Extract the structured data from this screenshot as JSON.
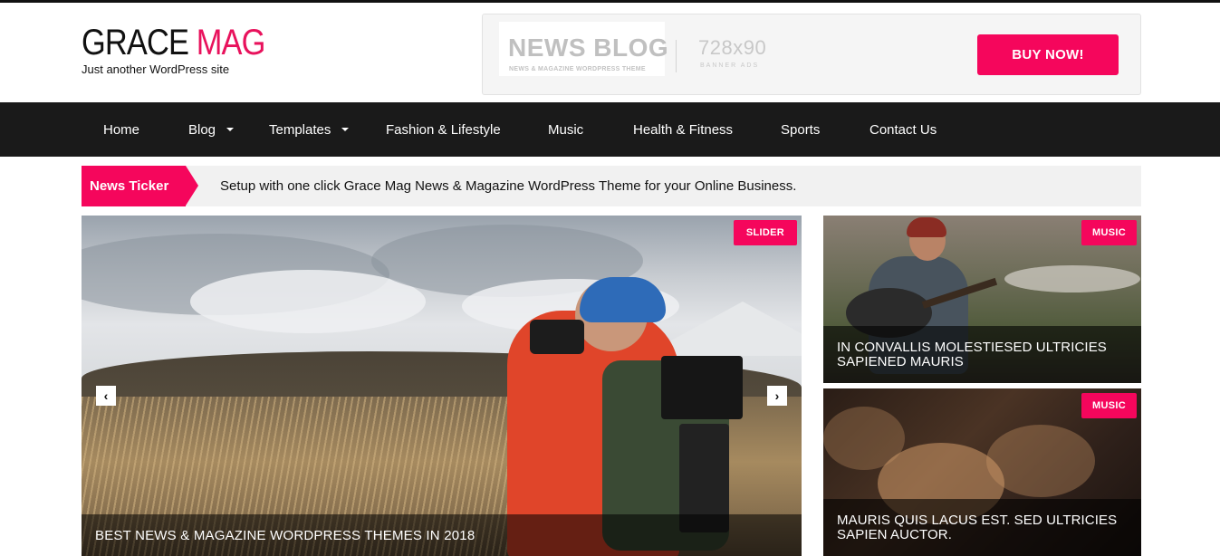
{
  "header": {
    "logo_word1": "GRACE",
    "logo_word2": "MAG",
    "tagline": "Just another WordPress site"
  },
  "banner": {
    "logo_title": "NEWS BLOG",
    "logo_subtitle": "NEWS & MAGAZINE WORDPRESS THEME",
    "size_label": "728x90",
    "ads_label": "BANNER ADS",
    "buy_label": "BUY NOW!"
  },
  "nav": {
    "items": [
      {
        "label": "Home"
      },
      {
        "label": "Blog"
      },
      {
        "label": "Templates"
      },
      {
        "label": "Fashion & Lifestyle"
      },
      {
        "label": "Music"
      },
      {
        "label": "Health & Fitness"
      },
      {
        "label": "Sports"
      },
      {
        "label": "Contact Us"
      }
    ]
  },
  "ticker": {
    "label": "News Ticker",
    "text": "Setup with one click Grace Mag News & Magazine WordPress Theme for your Online Business."
  },
  "slider": {
    "badge": "SLIDER",
    "prev_icon": "‹",
    "next_icon": "›",
    "caption": "BEST NEWS & MAGAZINE WORDPRESS THEMES IN 2018"
  },
  "side_posts": [
    {
      "badge": "MUSIC",
      "title": "IN CONVALLIS MOLESTIESED ULTRICIES SAPIENED MAURIS"
    },
    {
      "badge": "MUSIC",
      "title": "MAURIS QUIS LACUS EST. SED ULTRICIES SAPIEN AUCTOR."
    }
  ],
  "colors": {
    "accent": "#f5065c",
    "nav_bg": "#1a1a1a",
    "ticker_bg": "#f1f1f1"
  },
  "icons": {
    "prev": "chevron-left-icon",
    "next": "chevron-right-icon",
    "dropdown": "caret-down-icon"
  }
}
